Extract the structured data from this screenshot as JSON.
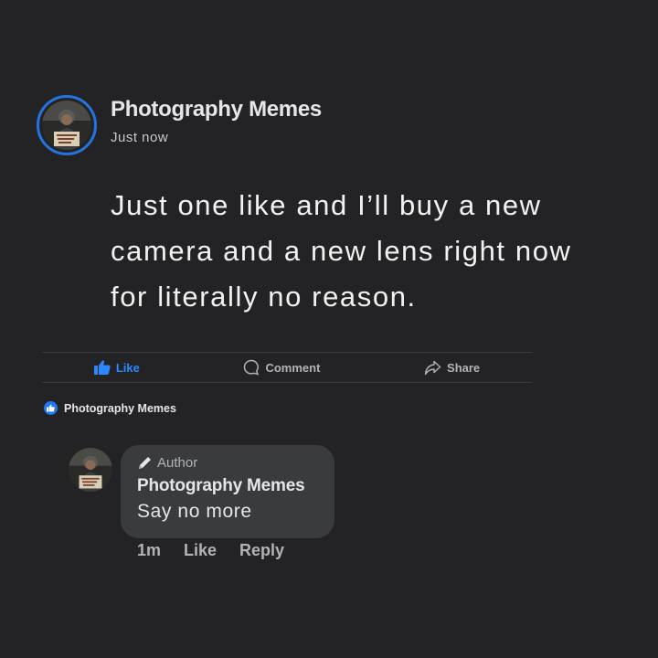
{
  "post": {
    "page_name": "Photography Memes",
    "timestamp": "Just now",
    "body": "Just one like and I’ll buy a new\ncamera and a new lens right now\nfor literally no reason."
  },
  "actions": {
    "like": "Like",
    "comment": "Comment",
    "share": "Share"
  },
  "reactions": {
    "reactor": "Photography Memes"
  },
  "comment": {
    "author_tag": "Author",
    "name": "Photography Memes",
    "text": "Say no more",
    "time": "1m",
    "like": "Like",
    "reply": "Reply"
  },
  "colors": {
    "background": "#232325",
    "accent": "#2374e1",
    "bubble": "#3a3b3c"
  },
  "icons": [
    "thumbs-up-icon",
    "comment-bubble-icon",
    "share-arrow-icon",
    "pencil-icon"
  ]
}
